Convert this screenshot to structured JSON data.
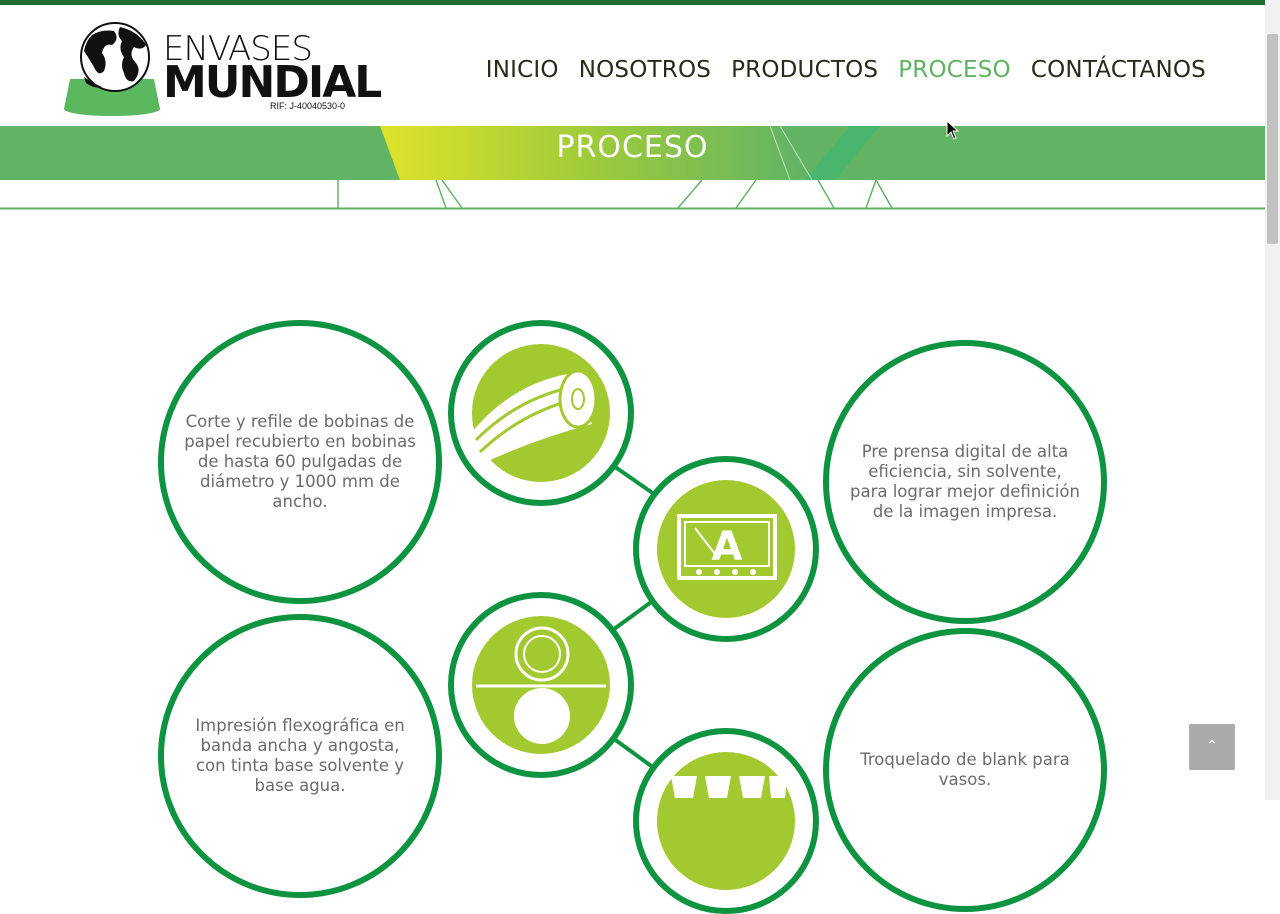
{
  "brand": {
    "name_line1": "ENVASES",
    "name_line2": "MUNDIAL",
    "rif": "RIF: J-40040530-0"
  },
  "nav": {
    "items": [
      {
        "label": "INICIO",
        "active": false
      },
      {
        "label": "NOSOTROS",
        "active": false
      },
      {
        "label": "PRODUCTOS",
        "active": false
      },
      {
        "label": "PROCESO",
        "active": true
      },
      {
        "label": "CONTÁCTANOS",
        "active": false
      }
    ]
  },
  "banner": {
    "title": "PROCESO"
  },
  "process": {
    "steps": [
      {
        "text": "Corte y refile de bobinas de papel recubierto en bobinas de hasta 60 pulgadas de diámetro y 1000 mm de ancho.",
        "icon": "paper-roll-icon"
      },
      {
        "text": "Pre prensa digital de alta eficiencia, sin solvente, para lograr mejor definición de la imagen impresa.",
        "icon": "digital-prepress-icon"
      },
      {
        "text": "Impresión flexográfica en banda ancha y angosta, con tinta base solvente y base agua.",
        "icon": "flexo-printing-icon"
      },
      {
        "text": "Troquelado de blank para vasos.",
        "icon": "die-cutting-icon"
      }
    ]
  },
  "colors": {
    "brand_green": "#62b464",
    "ring_green": "#0e9340",
    "icon_fill": "#a3c931",
    "nav_active": "#5fb55f"
  },
  "back_to_top": {
    "icon": "chevron-up-icon"
  }
}
